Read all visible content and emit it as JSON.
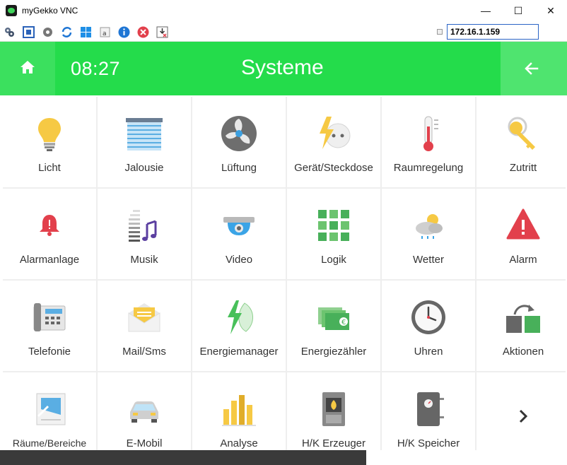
{
  "window": {
    "title": "myGekko VNC"
  },
  "toolbar": {
    "ip_value": "172.16.1.159"
  },
  "header": {
    "time": "08:27",
    "title": "Systeme"
  },
  "tiles": [
    {
      "label": "Licht"
    },
    {
      "label": "Jalousie"
    },
    {
      "label": "Lüftung"
    },
    {
      "label": "Gerät/Steckdose"
    },
    {
      "label": "Raumregelung"
    },
    {
      "label": "Zutritt"
    },
    {
      "label": "Alarmanlage"
    },
    {
      "label": "Musik"
    },
    {
      "label": "Video"
    },
    {
      "label": "Logik"
    },
    {
      "label": "Wetter"
    },
    {
      "label": "Alarm"
    },
    {
      "label": "Telefonie"
    },
    {
      "label": "Mail/Sms"
    },
    {
      "label": "Energiemanager"
    },
    {
      "label": "Energiezähler"
    },
    {
      "label": "Uhren"
    },
    {
      "label": "Aktionen"
    },
    {
      "label": "Räume/Bereiche"
    },
    {
      "label": "E-Mobil"
    },
    {
      "label": "Analyse"
    },
    {
      "label": "H/K Erzeuger"
    },
    {
      "label": "H/K Speicher"
    }
  ]
}
